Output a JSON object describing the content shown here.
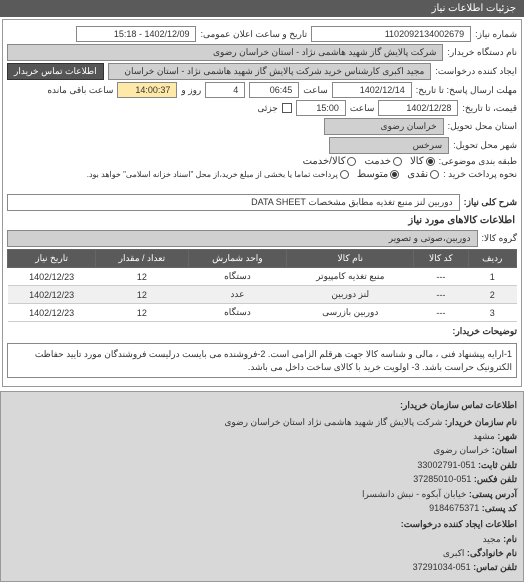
{
  "header": "جزئیات اطلاعات نیاز",
  "fields": {
    "req_no_label": "شماره نیاز:",
    "req_no": "1102092134002679",
    "pub_date_label": "تاریخ و ساعت اعلان عمومی:",
    "pub_date": "1402/12/09 - 15:18",
    "buyer_label": "نام دستگاه خریدار:",
    "buyer": "شرکت پالایش گاز شهید هاشمی نژاد - استان خراسان رضوی",
    "requester_label": "ایجاد کننده درخواست:",
    "requester": "مجید اکبری کارشناس خرید شرکت پالایش گاز شهید هاشمی نژاد - استان خراسان",
    "contact_btn": "اطلاعات تماس خریدار",
    "deadline_label": "مهلت ارسال پاسخ: تا تاریخ:",
    "deadline_date": "1402/12/14",
    "deadline_time_label": "ساعت",
    "deadline_time": "06:45",
    "remain_days": "4",
    "remain_days_label": "روز و",
    "remain_time": "14:00:37",
    "remain_time_label": "ساعت باقی مانده",
    "price_until_label": "قیمت، تا تاریخ:",
    "price_until_date": "1402/12/28",
    "price_until_time_label": "ساعت",
    "price_until_time": "15:00",
    "partial_label": "جزئی",
    "delivery_province_label": "استان محل تحویل:",
    "delivery_province": "خراسان رضوی",
    "delivery_city_label": "شهر محل تحویل:",
    "delivery_city": "سرخس",
    "budget_label": "طبقه بندی موضوعی:",
    "budget_opts": [
      "کالا",
      "خدمت",
      "کالا/خدمت"
    ],
    "budget_checked": 0,
    "pay_label": "نحوه پرداخت خرید :",
    "pay_opts": [
      "نقدی",
      "متوسط",
      "پرداخت تماما یا بخشی از مبلغ خرید،از محل \"اسناد خزانه اسلامی\" خواهد بود."
    ],
    "pay_checked": 1,
    "desc_label": "شرح کلی نیاز:",
    "desc": "دوربین لنز منبع تغذیه مطابق مشخصات DATA SHEET"
  },
  "goods_title": "اطلاعات کالاهای مورد نیاز",
  "goods_group_label": "گروه کالا:",
  "goods_group": "دوربین،صوتی و تصویر",
  "table": {
    "headers": [
      "ردیف",
      "کد کالا",
      "نام کالا",
      "واحد شمارش",
      "تعداد / مقدار",
      "تاریخ نیاز"
    ],
    "rows": [
      [
        "1",
        "---",
        "منبع تغذیه کامپیوتر",
        "دستگاه",
        "12",
        "1402/12/23"
      ],
      [
        "2",
        "---",
        "لنز دوربین",
        "عدد",
        "12",
        "1402/12/23"
      ],
      [
        "3",
        "---",
        "دوربین بازرسی",
        "دستگاه",
        "12",
        "1402/12/23"
      ]
    ]
  },
  "buyer_notes_label": "توضیحات خریدار:",
  "buyer_notes": "1-ارایه پیشنهاد فنی ، مالی و شناسه کالا جهت هرقلم الزامی است. 2-فروشنده می بایست درلیست فروشندگان مورد تایید حفاظت الکترونیک حراست باشد. 3- اولویت خرید با کالای ساخت داخل می باشد.",
  "contact": {
    "title": "اطلاعات تماس سازمان خریدار:",
    "org_label": "نام سازمان خریدار:",
    "org": "شرکت پالایش گاز شهید هاشمی نژاد استان خراسان رضوی",
    "city_label": "شهر:",
    "city": "مشهد",
    "province_label": "استان:",
    "province": "خراسان رضوی",
    "phone_label": "تلفن ثابت:",
    "phone": "051-33002791",
    "fax_label": "تلفن فکس:",
    "fax": "051-37285010",
    "addr_label": "آدرس پستی:",
    "addr": "خیابان آبکوه - نبش دانشسرا",
    "post_label": "کد پستی:",
    "post": "9184675371",
    "creator_title": "اطلاعات ایجاد کننده درخواست:",
    "name_label": "نام:",
    "name": "مجید",
    "lname_label": "نام خانوادگی:",
    "lname": "اکبری",
    "cphone_label": "تلفن تماس:",
    "cphone": "051-37291034"
  }
}
